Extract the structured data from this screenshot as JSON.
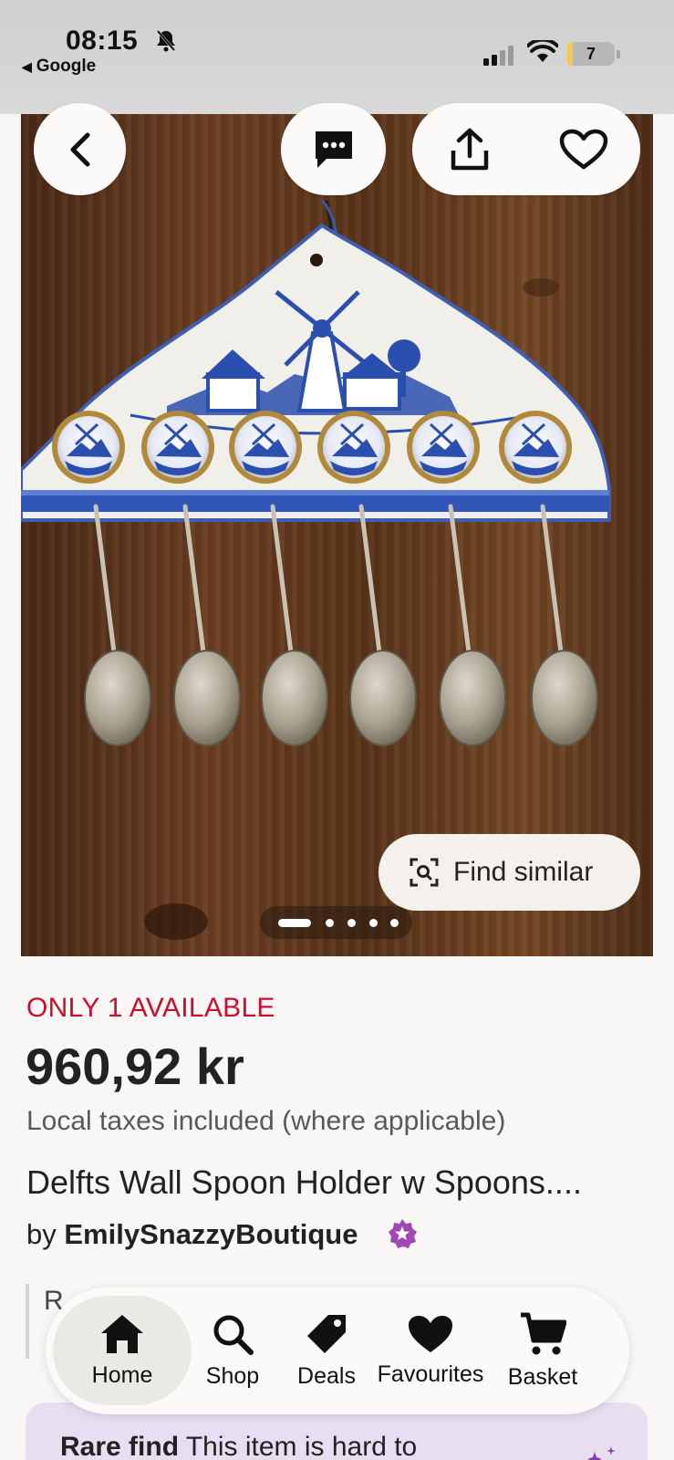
{
  "status_bar": {
    "time": "08:15",
    "back_app_label": "Google",
    "battery_level": "7",
    "battery_fraction": 0.07
  },
  "hero": {
    "image_alt": "Delft blue ceramic wall spoon holder with six spoons",
    "find_similar_label": "Find similar",
    "page_count": 5,
    "active_page": 1
  },
  "listing": {
    "availability": "ONLY 1 AVAILABLE",
    "price": "960,92 kr",
    "tax_note": "Local taxes included (where applicable)",
    "title": "Delfts Wall Spoon Holder w Spoons....",
    "by_label": "by",
    "shop_name": "EmilySnazzyBoutique",
    "reviews_stub": "R"
  },
  "bottom_nav": {
    "items": [
      {
        "label": "Home",
        "icon": "home-icon",
        "active": true
      },
      {
        "label": "Shop",
        "icon": "search-icon"
      },
      {
        "label": "Deals",
        "icon": "tag-icon"
      },
      {
        "label": "Favourites",
        "icon": "heart-icon"
      },
      {
        "label": "Basket",
        "icon": "cart-icon"
      }
    ]
  },
  "rare_find": {
    "title": "Rare find",
    "text": " This item is hard to"
  },
  "colors": {
    "accent_red": "#c8102e",
    "star_seller_purple": "#a148b5",
    "rare_bg": "#e8def2"
  }
}
